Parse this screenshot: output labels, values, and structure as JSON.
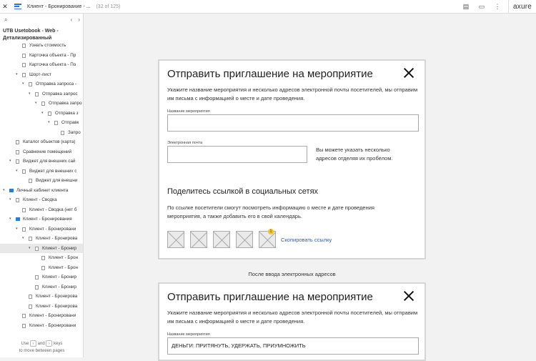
{
  "topbar": {
    "title": "Клиент - Бронирование - ...",
    "count": "(32 of 125)",
    "logo": "axure"
  },
  "sidebar": {
    "project": "UTB Usetobook - Web - Детализированный",
    "items": [
      {
        "label": "Узнать стоимость",
        "depth": 3,
        "type": "page",
        "caret": ""
      },
      {
        "label": "Карточка объекта - Пр",
        "depth": 3,
        "type": "page",
        "caret": ""
      },
      {
        "label": "Карточка объекта - По",
        "depth": 3,
        "type": "page",
        "caret": ""
      },
      {
        "label": "Шорт-лист",
        "depth": 3,
        "type": "page",
        "caret": "▾"
      },
      {
        "label": "Отправка запроса -",
        "depth": 4,
        "type": "page",
        "caret": "▾"
      },
      {
        "label": "Отправка запрос",
        "depth": 5,
        "type": "page",
        "caret": "▾"
      },
      {
        "label": "Отправка запро",
        "depth": 6,
        "type": "page",
        "caret": "▾"
      },
      {
        "label": "Отправка з",
        "depth": 7,
        "type": "page",
        "caret": "▾"
      },
      {
        "label": "Отправк",
        "depth": 8,
        "type": "page",
        "caret": "▾"
      },
      {
        "label": "Запро",
        "depth": 9,
        "type": "page",
        "caret": ""
      },
      {
        "label": "Каталог объектов (карта)",
        "depth": 2,
        "type": "page",
        "caret": ""
      },
      {
        "label": "Сравнение помещений",
        "depth": 2,
        "type": "page",
        "caret": ""
      },
      {
        "label": "Виджет для внешних сай",
        "depth": 2,
        "type": "page",
        "caret": "▾"
      },
      {
        "label": "Виджет для внешних с",
        "depth": 3,
        "type": "page",
        "caret": "▾"
      },
      {
        "label": "Виджет для внешни",
        "depth": 4,
        "type": "page",
        "caret": ""
      },
      {
        "label": "Личный кабинет клиента",
        "depth": 1,
        "type": "folder",
        "caret": "▾"
      },
      {
        "label": "Клиент - Сводка",
        "depth": 2,
        "type": "page",
        "caret": "▾"
      },
      {
        "label": "Клиент - Сводка (нет б",
        "depth": 3,
        "type": "page",
        "caret": ""
      },
      {
        "label": "Клиент - Бронирования",
        "depth": 2,
        "type": "folder",
        "caret": "▾"
      },
      {
        "label": "Клиент - Бронировани",
        "depth": 3,
        "type": "page",
        "caret": "▾"
      },
      {
        "label": "Клиент - Бронирова",
        "depth": 4,
        "type": "page",
        "caret": "▾"
      },
      {
        "label": "Клиент - Бронир",
        "depth": 5,
        "type": "page",
        "caret": "▾",
        "selected": true
      },
      {
        "label": "Клиент - Брон",
        "depth": 6,
        "type": "page",
        "caret": ""
      },
      {
        "label": "Клиент - Брон",
        "depth": 6,
        "type": "page",
        "caret": ""
      },
      {
        "label": "Клиент - Бронир",
        "depth": 5,
        "type": "page",
        "caret": ""
      },
      {
        "label": "Клиент - Бронир",
        "depth": 5,
        "type": "page",
        "caret": ""
      },
      {
        "label": "Клиент - Бронирова",
        "depth": 4,
        "type": "page",
        "caret": ""
      },
      {
        "label": "Клиент - Бронирова",
        "depth": 4,
        "type": "page",
        "caret": ""
      },
      {
        "label": "Клиент - Бронировани",
        "depth": 3,
        "type": "page",
        "caret": ""
      },
      {
        "label": "Клиент - Бронировани",
        "depth": 3,
        "type": "page",
        "caret": ""
      }
    ],
    "footer": {
      "use": "Use",
      "and": "and",
      "keys": "keys",
      "line2": "to move between pages",
      "key1": "‹",
      "key2": "›"
    }
  },
  "modal1": {
    "title": "Отправить приглашение на мероприятие",
    "description": "Укажите название мероприятия и несколько адресов электронной почты посетителей, мы отправим им письма с информацией о месте и дате проведения.",
    "event_label": "Название мероприятия",
    "event_value": "",
    "email_label": "Электронная почта",
    "email_value": "",
    "email_hint": "Вы можете указать несколько адресов отделяя их пробелом.",
    "share_title": "Поделитесь ссылкой в социальных сетях",
    "share_desc": "По ссылке посетители смогут посмотреть информацию о месте и дате проведения мероприятия, а также добавить его в свой календарь.",
    "badge": "1",
    "copy_link": "Скопировать ссылку"
  },
  "caption": "После ввода электронных адресов",
  "modal2": {
    "title": "Отправить приглашение на мероприятие",
    "description": "Укажите название мероприятия и несколько адресов электронной почты посетителей, мы отправим им письма с информацией о месте и дате проведения.",
    "event_label": "Название мероприятия",
    "event_value": "ДЕНЬГИ: ПРИТЯНУТЬ, УДЕРЖАТЬ, ПРИУМНОЖИТЬ"
  }
}
